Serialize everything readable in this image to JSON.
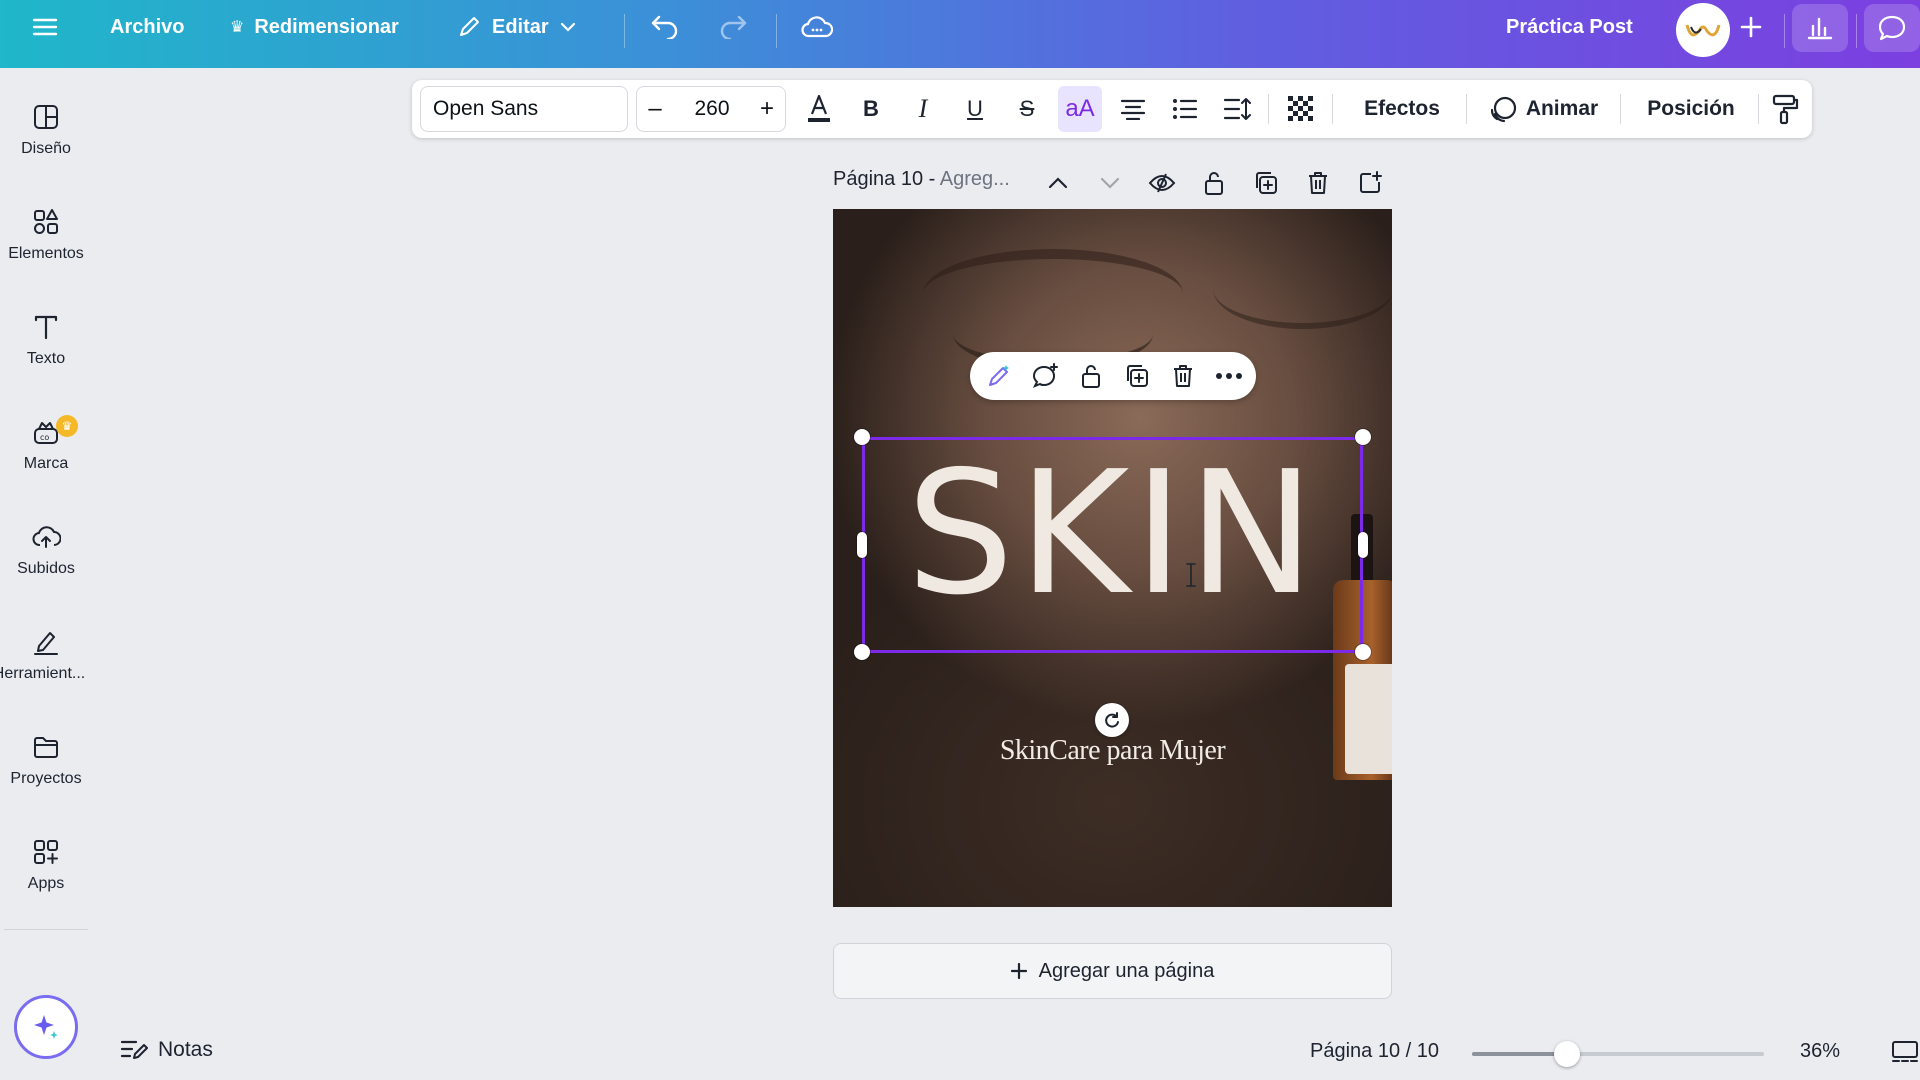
{
  "topbar": {
    "menu_icon": "hamburger-menu-icon",
    "file_label": "Archivo",
    "resize_label": "Redimensionar",
    "edit_label": "Editar",
    "project_title": "Práctica Post",
    "add_icon": "plus-icon",
    "insights_icon": "bar-chart-icon",
    "comments_icon": "comment-icon"
  },
  "sidebar": {
    "items": [
      {
        "label": "Diseño",
        "icon": "layout-icon"
      },
      {
        "label": "Elementos",
        "icon": "shapes-icon"
      },
      {
        "label": "Texto",
        "icon": "text-icon"
      },
      {
        "label": "Marca",
        "icon": "brand-icon"
      },
      {
        "label": "Subidos",
        "icon": "upload-cloud-icon"
      },
      {
        "label": "Herramient...",
        "icon": "pen-tool-icon"
      },
      {
        "label": "Proyectos",
        "icon": "folder-icon"
      },
      {
        "label": "Apps",
        "icon": "apps-grid-icon"
      }
    ]
  },
  "toolbar": {
    "font_family": "Open Sans",
    "font_size": "260",
    "minus": "–",
    "plus": "+",
    "case_label": "aA",
    "effects_label": "Efectos",
    "animate_label": "Animar",
    "position_label": "Posición"
  },
  "page": {
    "label": "Página 10 - ",
    "title_placeholder": "Agreg..."
  },
  "canvas": {
    "headline": "SKIN",
    "subtitle": "SkinCare para Mujer"
  },
  "add_page_label": "Agregar una página",
  "bottombar": {
    "notes_label": "Notas",
    "page_count": "Página 10 / 10",
    "zoom_label": "36%",
    "zoom_fraction": 0.36
  },
  "colors": {
    "accent": "#7d2ae8",
    "selection": "#7d2ae8",
    "brand_gradient_start": "#1fb7c9",
    "brand_gradient_end": "#7c3fe0"
  }
}
